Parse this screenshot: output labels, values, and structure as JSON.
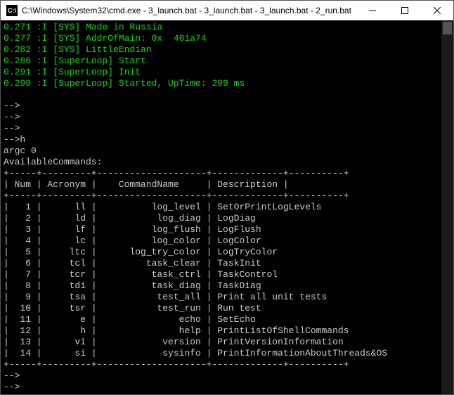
{
  "window": {
    "icon_text": "C:\\",
    "title": "C:\\Windows\\System32\\cmd.exe - 3_launch.bat - 3_launch.bat - 3_launch.bat - 2_run.bat"
  },
  "boot": [
    {
      "t": "0.271",
      "tag": "[SYS]",
      "msg": "Made in Russia"
    },
    {
      "t": "0.277",
      "tag": "[SYS]",
      "msg": "AddrOfMain: 0x  401a74"
    },
    {
      "t": "0.282",
      "tag": "[SYS]",
      "msg": "LittleEndian"
    },
    {
      "t": "0.286",
      "tag": "[SuperLoop]",
      "msg": "Start"
    },
    {
      "t": "0.291",
      "tag": "[SuperLoop]",
      "msg": "Init"
    },
    {
      "t": "0.299",
      "tag": "[SuperLoop]",
      "msg": "Started, UpTime: 299 ms"
    }
  ],
  "prompt_lines": [
    "-->",
    "-->",
    "-->",
    "-->h"
  ],
  "argc_line": "argc 0",
  "available_label": "AvailableCommands:",
  "table": {
    "headers": {
      "num": "Num",
      "acronym": "Acronym",
      "command": "CommandName",
      "desc": "Description"
    },
    "rows": [
      {
        "num": "1",
        "acronym": "ll",
        "command": "log_level",
        "desc": "SetOrPrintLogLevels"
      },
      {
        "num": "2",
        "acronym": "ld",
        "command": "log_diag",
        "desc": "LogDiag"
      },
      {
        "num": "3",
        "acronym": "lf",
        "command": "log_flush",
        "desc": "LogFlush"
      },
      {
        "num": "4",
        "acronym": "lc",
        "command": "log_color",
        "desc": "LogColor"
      },
      {
        "num": "5",
        "acronym": "ltc",
        "command": "log_try_color",
        "desc": "LogTryColor"
      },
      {
        "num": "6",
        "acronym": "tcl",
        "command": "task_clear",
        "desc": "TaskInit"
      },
      {
        "num": "7",
        "acronym": "tcr",
        "command": "task_ctrl",
        "desc": "TaskControl"
      },
      {
        "num": "8",
        "acronym": "tdi",
        "command": "task_diag",
        "desc": "TaskDiag"
      },
      {
        "num": "9",
        "acronym": "tsa",
        "command": "test_all",
        "desc": "Print all unit tests"
      },
      {
        "num": "10",
        "acronym": "tsr",
        "command": "test_run",
        "desc": "Run test"
      },
      {
        "num": "11",
        "acronym": "e",
        "command": "echo",
        "desc": "SetEcho"
      },
      {
        "num": "12",
        "acronym": "h",
        "command": "help",
        "desc": "PrintListOfShellCommands"
      },
      {
        "num": "13",
        "acronym": "vi",
        "command": "version",
        "desc": "PrintVersionInformation"
      },
      {
        "num": "14",
        "acronym": "si",
        "command": "sysinfo",
        "desc": "PrintInformationAboutThreads&OS"
      }
    ]
  },
  "trailing_prompts": [
    "-->",
    "-->"
  ]
}
